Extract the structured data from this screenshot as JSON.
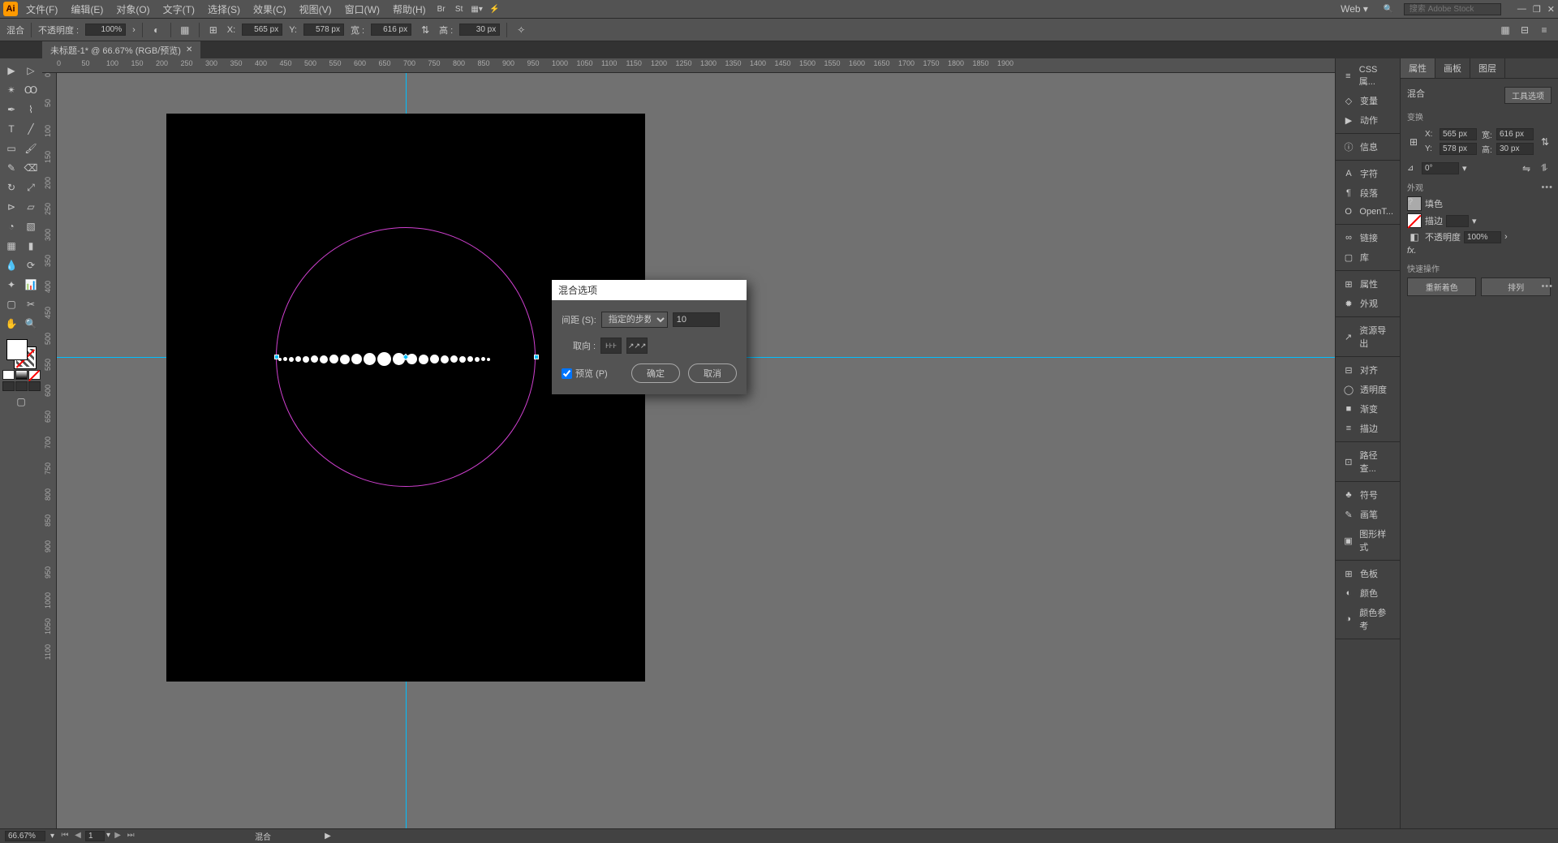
{
  "app": {
    "icon_text": "Ai"
  },
  "menu": [
    "文件(F)",
    "编辑(E)",
    "对象(O)",
    "文字(T)",
    "选择(S)",
    "效果(C)",
    "视图(V)",
    "窗口(W)",
    "帮助(H)"
  ],
  "menu_right": {
    "workspace": "Web",
    "search_placeholder": "搜索 Adobe Stock"
  },
  "control": {
    "type_label": "混合",
    "opacity_label": "不透明度 :",
    "opacity_value": "100%",
    "x_label": "X:",
    "x_value": "565 px",
    "y_label": "Y:",
    "y_value": "578 px",
    "w_label": "宽 :",
    "w_value": "616 px",
    "h_label": "高 :",
    "h_value": "30 px"
  },
  "tab": {
    "title": "未标题-1* @ 66.67% (RGB/预览)"
  },
  "ruler_h": [
    0,
    50,
    100,
    150,
    200,
    250,
    300,
    350,
    400,
    450,
    500,
    550,
    600,
    650,
    700,
    750,
    800,
    850,
    900,
    950,
    1000,
    1050,
    1100,
    1150,
    1200,
    1250,
    1300,
    1350,
    1400,
    1450,
    1500,
    1550,
    1600,
    1650,
    1700,
    1750,
    1800,
    1850,
    1900
  ],
  "ruler_v": [
    0,
    50,
    100,
    150,
    200,
    250,
    300,
    350,
    400,
    450,
    500,
    550,
    600,
    650,
    700,
    750,
    800,
    850,
    900,
    950,
    1000,
    1050,
    1100
  ],
  "panel_strip": [
    {
      "section": [
        {
          "icon": "≡",
          "label": "CSS 属..."
        },
        {
          "icon": "◇",
          "label": "变量"
        },
        {
          "icon": "▶",
          "label": "动作"
        }
      ]
    },
    {
      "section": [
        {
          "icon": "ⓘ",
          "label": "信息"
        }
      ]
    },
    {
      "section": [
        {
          "icon": "A",
          "label": "字符"
        },
        {
          "icon": "¶",
          "label": "段落"
        },
        {
          "icon": "O",
          "label": "OpenT..."
        }
      ]
    },
    {
      "section": [
        {
          "icon": "∞",
          "label": "链接"
        },
        {
          "icon": "▢",
          "label": "库"
        }
      ]
    },
    {
      "section": [
        {
          "icon": "⊞",
          "label": "属性"
        },
        {
          "icon": "✹",
          "label": "外观"
        }
      ]
    },
    {
      "section": [
        {
          "icon": "↗",
          "label": "资源导出"
        }
      ]
    },
    {
      "section": [
        {
          "icon": "⊟",
          "label": "对齐"
        },
        {
          "icon": "◯",
          "label": "透明度"
        },
        {
          "icon": "■",
          "label": "渐变"
        },
        {
          "icon": "≡",
          "label": "描边"
        }
      ]
    },
    {
      "section": [
        {
          "icon": "⊡",
          "label": "路径查..."
        }
      ]
    },
    {
      "section": [
        {
          "icon": "♣",
          "label": "符号"
        },
        {
          "icon": "✎",
          "label": "画笔"
        },
        {
          "icon": "▣",
          "label": "图形样式"
        }
      ]
    },
    {
      "section": [
        {
          "icon": "⊞",
          "label": "色板"
        },
        {
          "icon": "◐",
          "label": "颜色"
        },
        {
          "icon": "◑",
          "label": "颜色参考"
        }
      ]
    }
  ],
  "props": {
    "tabs": [
      "属性",
      "画板",
      "图层"
    ],
    "active_tab": 0,
    "obj_type": "混合",
    "tool_options": "工具选项",
    "transform_title": "变换",
    "x_label": "X:",
    "x_value": "565 px",
    "y_label": "Y:",
    "y_value": "578 px",
    "w_label": "宽:",
    "w_value": "616 px",
    "h_label": "高:",
    "h_value": "30 px",
    "angle_label": "⊿",
    "angle_value": "0°",
    "appearance_title": "外观",
    "fill_label": "填色",
    "stroke_label": "描边",
    "opacity_label": "不透明度",
    "opacity_value": "100%",
    "fx_label": "fx.",
    "quick_title": "快速操作",
    "qa_recolor": "重新着色",
    "qa_arrange": "排列"
  },
  "dialog": {
    "title": "混合选项",
    "spacing_label": "间距 (S):",
    "spacing_mode": "指定的步数",
    "spacing_value": "10",
    "orient_label": "取向 :",
    "preview_label": "预览 (P)",
    "ok": "确定",
    "cancel": "取消"
  },
  "status": {
    "zoom": "66.67%",
    "artboard_num": "1",
    "tool": "混合"
  }
}
